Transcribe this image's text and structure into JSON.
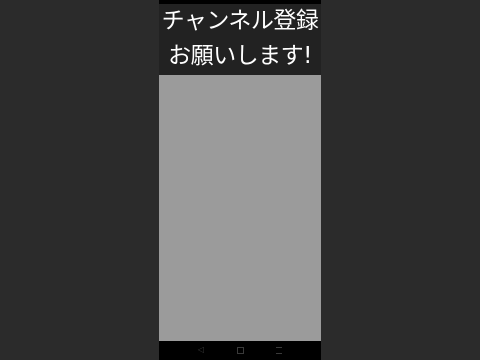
{
  "caption": {
    "line1": "チャンネル登録",
    "line2": "お願いします!"
  },
  "navbar": {
    "back_icon": "back-triangle-icon",
    "home_icon": "home-square-icon",
    "recents_icon": "recents-lines-icon"
  },
  "colors": {
    "background": "#2b2b2b",
    "caption_bg": "#222222",
    "content_bg": "#9b9b9b",
    "caption_text": "#ffffff"
  }
}
